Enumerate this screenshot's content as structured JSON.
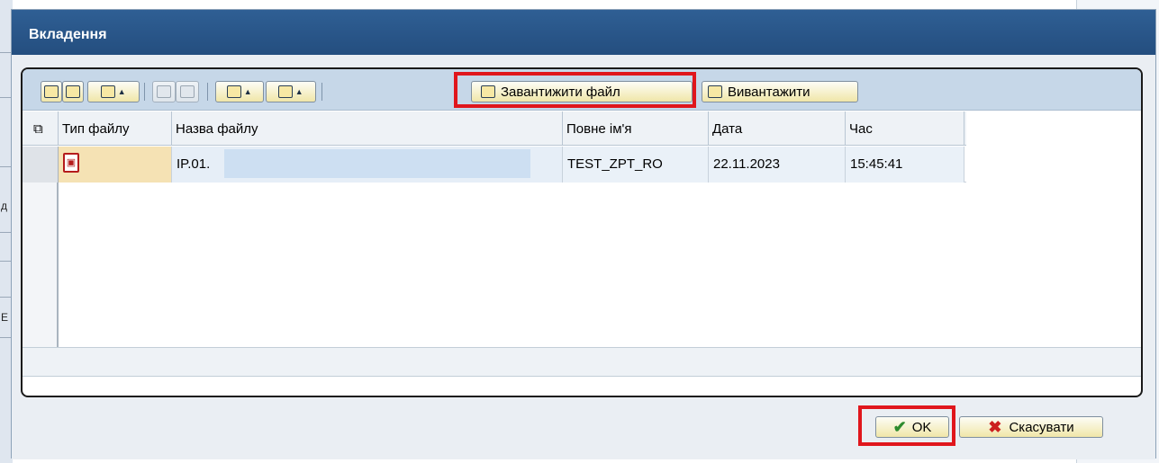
{
  "dialog": {
    "title": "Вкладення"
  },
  "toolbar": {
    "upload_label": "Завантижити файл",
    "download_label": "Вивантажити"
  },
  "table": {
    "columns": [
      "Тип файлу",
      "Назва файлу",
      "Повне ім'я",
      "Дата",
      "Час"
    ],
    "rows": [
      {
        "type_icon": "pdf-icon",
        "name": "IP.01.",
        "full_name": "TEST_ZPT_RO",
        "date": "22.11.2023",
        "time": "15:45:41"
      }
    ]
  },
  "buttons": {
    "ok_label": "OK",
    "cancel_label": "Скасувати"
  },
  "colors": {
    "title_bar": "#2f5f94",
    "toolbar": "#c6d7e8",
    "highlight": "#e0161c",
    "button": "#f0e6a8"
  }
}
